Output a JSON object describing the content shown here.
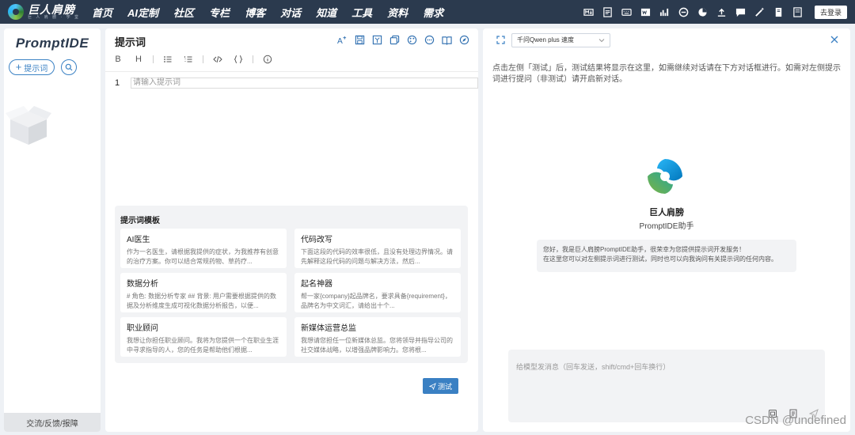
{
  "topnav": {
    "logo_name": "巨人肩膀",
    "logo_sub": "巨 人 肩 膀 · 学 堂",
    "items": [
      "首页",
      "AI定制",
      "社区",
      "专栏",
      "博客",
      "对话",
      "知道",
      "工具",
      "资料",
      "需求"
    ],
    "right_icons": [
      "markdown-icon",
      "document-icon",
      "keyboard-icon",
      "word-icon",
      "chart-icon",
      "edge-icon",
      "pie-icon",
      "upload-icon",
      "chat-icon",
      "magic-wand-icon",
      "book-icon",
      "note-icon"
    ],
    "login_label": "去登录"
  },
  "sidebar": {
    "brand": "PromptIDE",
    "add_label": "提示词",
    "feedback_label": "交流/反馈/报障"
  },
  "editor": {
    "title": "提示词",
    "tools": [
      "ai-icon",
      "save-icon",
      "format-icon",
      "copy-icon",
      "palette-icon",
      "more-icon",
      "book-icon",
      "compass-icon"
    ],
    "format_bar": [
      "B",
      "H"
    ],
    "line_number": "1",
    "placeholder": "请输入提示词",
    "templates_title": "提示词模板",
    "templates": [
      {
        "name": "AI医生",
        "desc": "作为一名医生，请根据我提供的症状，为我推荐有创意的治疗方案。你可以结合常规药物、草药疗..."
      },
      {
        "name": "代码改写",
        "desc": "下面这段的代码的效率很低，且没有处理边界情况。请先解释这段代码的问题与解决方法，然后..."
      },
      {
        "name": "数据分析",
        "desc": "# 角色: 数据分析专家 ## 背景: 用户需要根据提供的数据及分析维度生成可视化数据分析报告，以便..."
      },
      {
        "name": "起名神器",
        "desc": "帮一家{company}起品牌名，要求具备{requirement}，品牌名为中文词汇，请给出十个..."
      },
      {
        "name": "职业顾问",
        "desc": "我想让你担任职业顾问。我将为您提供一个在职业生涯中寻求指导的人，您的任务是帮助他们根据..."
      },
      {
        "name": "新媒体运营总监",
        "desc": "我想请您担任一位新媒体总监。您将领导并指导公司的社交媒体战略，以增强品牌影响力。您将根..."
      }
    ],
    "test_label": "测试"
  },
  "chat": {
    "model": "千问Qwen plus 速度",
    "hint": "点击左侧「测试」后，测试结果将显示在这里，如需继续对话请在下方对话框进行。如需对左侧提示词进行提问（非测试）请开启新对话。",
    "bot_name": "巨人肩膀",
    "bot_sub": "PromptIDE助手",
    "welcome_line1": "您好，我是巨人肩膀PromptIDE助手，很荣幸为您提供提示词开发服务！",
    "welcome_line2": "在这里您可以对左侧提示词进行测试，同时也可以向我询问有关提示词的任何内容。",
    "input_placeholder": "给模型发消息（回车发送，shift/cmd+回车换行）",
    "watermark": "CSDN @undefined"
  },
  "colors": {
    "nav_bg": "#2b3a4e",
    "accent": "#3a80c3"
  }
}
